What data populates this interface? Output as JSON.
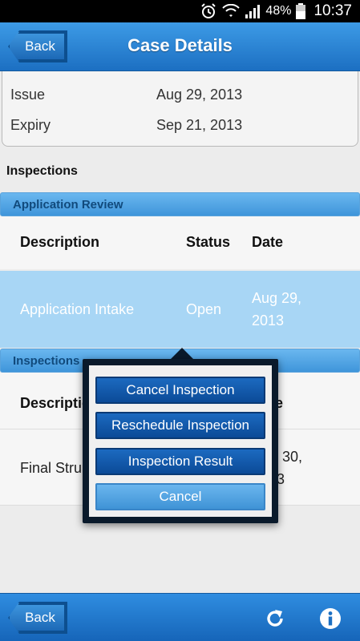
{
  "status_bar": {
    "battery": "48%",
    "time": "10:37"
  },
  "header": {
    "title": "Case Details",
    "back_label": "Back"
  },
  "info": [
    {
      "label": "Issue",
      "value": "Aug 29, 2013"
    },
    {
      "label": "Expiry",
      "value": "Sep 21, 2013"
    }
  ],
  "inspections": {
    "section_title": "Inspections",
    "groups": [
      {
        "header": "Application Review",
        "columns": [
          "Description",
          "Status",
          "Date"
        ],
        "rows": [
          {
            "description": "Application Intake",
            "status": "Open",
            "date_line1": "Aug 29,",
            "date_line2": "2013"
          }
        ]
      },
      {
        "header": "Inspections",
        "columns": [
          "Descriptio",
          "te"
        ],
        "rows": [
          {
            "description": "Final Stru",
            "date_line1": "30,",
            "date_line2": "3"
          }
        ]
      }
    ]
  },
  "popup": {
    "buttons": [
      "Cancel Inspection",
      "Reschedule Inspection",
      "Inspection Result"
    ],
    "cancel_label": "Cancel"
  },
  "footer": {
    "back_label": "Back"
  },
  "colors": {
    "accent": "#1c6fc2",
    "selected_row": "#a8d6f5"
  }
}
